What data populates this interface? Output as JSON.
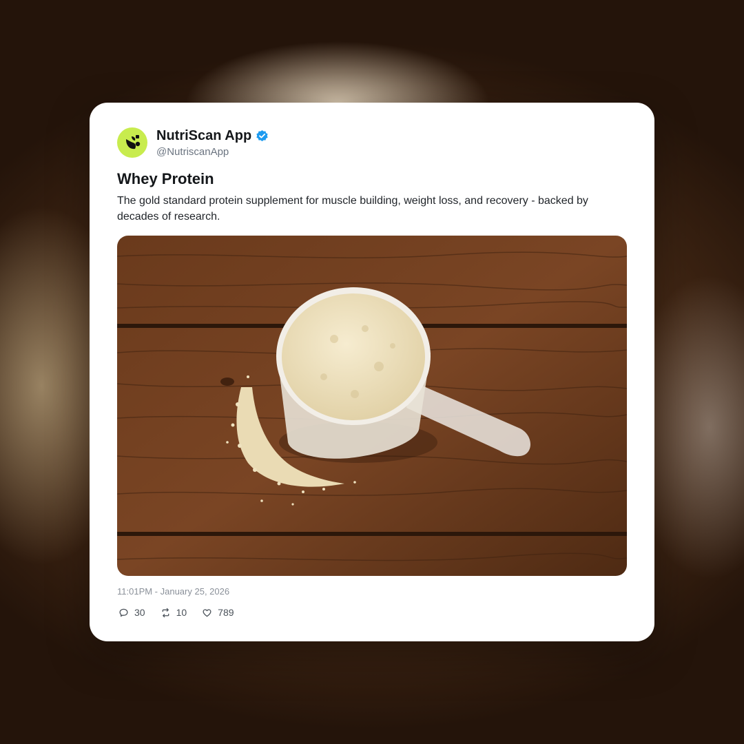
{
  "account": {
    "display_name": "NutriScan App",
    "handle": "@NutriscanApp",
    "avatar_icon": "nutriscan-logo-icon",
    "verified_icon": "verified-badge-icon",
    "avatar_color": "#c8ec4e",
    "verified_color": "#1d9bf0"
  },
  "post": {
    "title": "Whey Protein",
    "body": "The gold standard protein supplement for muscle building, weight loss, and recovery - backed by decades of research.",
    "image_icon": "whey-protein-scoop-photo",
    "timestamp": "11:01PM - January 25, 2026"
  },
  "actions": {
    "replies": {
      "icon": "reply-icon",
      "count": "30"
    },
    "reposts": {
      "icon": "repost-icon",
      "count": "10"
    },
    "likes": {
      "icon": "heart-icon",
      "count": "789"
    }
  }
}
